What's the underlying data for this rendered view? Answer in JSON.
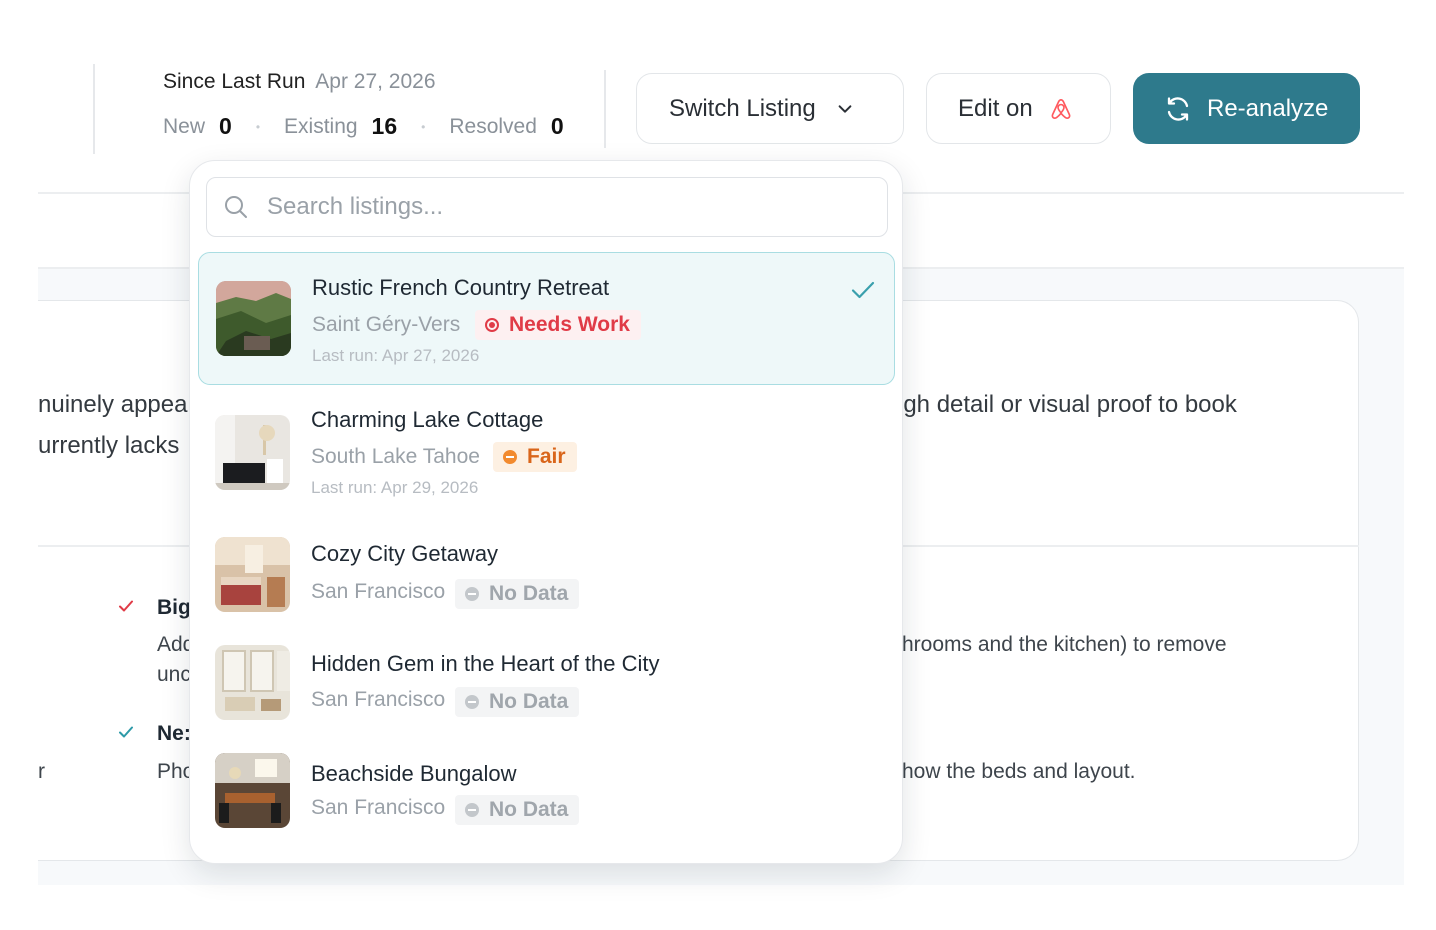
{
  "header": {
    "since_label": "Since Last Run",
    "since_date": "Apr 27, 2026",
    "counts": [
      {
        "label": "New",
        "value": "0"
      },
      {
        "label": "Existing",
        "value": "16"
      },
      {
        "label": "Resolved",
        "value": "0"
      }
    ],
    "switch_listing_label": "Switch Listing",
    "edit_on_label": "Edit on",
    "reanalyze_label": "Re-analyze"
  },
  "background": {
    "line1_left": "nuinely appea",
    "line2_left": "urrently lacks",
    "line1_right": "igh detail or visual proof to book",
    "item1_bold": "Big",
    "item1_line1": "Add",
    "item1_line2": "unc",
    "item1_right": "hrooms and the kitchen) to remove",
    "item2_bold": "Ne:",
    "item2_line1": "Pho",
    "item2_left": "r",
    "item2_right": "how the beds and layout."
  },
  "dropdown": {
    "search_placeholder": "Search listings...",
    "listings": [
      {
        "title": "Rustic French Country Retreat",
        "location": "Saint Géry-Vers",
        "status": "Needs Work",
        "last_run": "Last run: Apr 27, 2026",
        "selected": true
      },
      {
        "title": "Charming Lake Cottage",
        "location": "South Lake Tahoe",
        "status": "Fair",
        "last_run": "Last run: Apr 29, 2026",
        "selected": false
      },
      {
        "title": "Cozy City Getaway",
        "location": "San Francisco",
        "status": "No Data",
        "selected": false
      },
      {
        "title": "Hidden Gem in the Heart of the City",
        "location": "San Francisco",
        "status": "No Data",
        "selected": false
      },
      {
        "title": "Beachside Bungalow",
        "location": "San Francisco",
        "status": "No Data",
        "selected": false
      }
    ]
  },
  "colors": {
    "accent": "#2e7a8c",
    "needs_work": "#e03b47",
    "fair": "#f28a2e",
    "no_data": "#c3c7cb",
    "airbnb": "#ff5a5f"
  },
  "icons": [
    "chevron-down-icon",
    "airbnb-icon",
    "refresh-icon",
    "search-icon",
    "check-icon"
  ]
}
